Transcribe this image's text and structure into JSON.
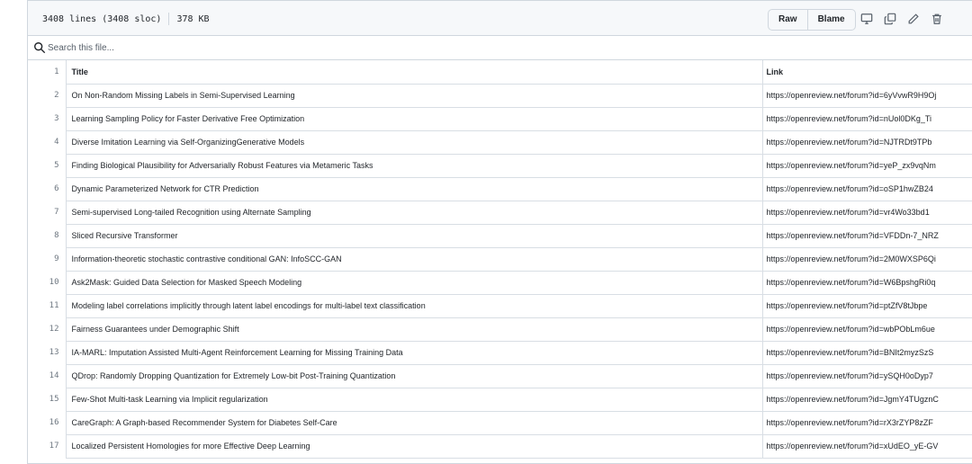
{
  "file_info": {
    "lines": "3408 lines (3408 sloc)",
    "size": "378 KB"
  },
  "toolbar": {
    "raw_label": "Raw",
    "blame_label": "Blame",
    "icons": [
      "display-icon",
      "copy-icon",
      "pencil-icon",
      "trash-icon"
    ]
  },
  "search": {
    "placeholder": "Search this file..."
  },
  "table": {
    "header": {
      "num": "1",
      "title": "Title",
      "link": "Link"
    },
    "rows": [
      {
        "num": "2",
        "title": "On Non-Random Missing Labels in Semi-Supervised Learning",
        "link": "https://openreview.net/forum?id=6yVvwR9H9Oj"
      },
      {
        "num": "3",
        "title": "Learning Sampling Policy for Faster Derivative Free Optimization",
        "link": "https://openreview.net/forum?id=nUol0DKg_Ti"
      },
      {
        "num": "4",
        "title": "Diverse Imitation Learning via Self-OrganizingGenerative Models",
        "link": "https://openreview.net/forum?id=NJTRDt9TPb"
      },
      {
        "num": "5",
        "title": "Finding Biological Plausibility for Adversarially Robust Features via Metameric Tasks",
        "link": "https://openreview.net/forum?id=yeP_zx9vqNm"
      },
      {
        "num": "6",
        "title": "Dynamic Parameterized Network for CTR Prediction",
        "link": "https://openreview.net/forum?id=oSP1hwZB24"
      },
      {
        "num": "7",
        "title": "Semi-supervised Long-tailed Recognition using Alternate Sampling",
        "link": "https://openreview.net/forum?id=vr4Wo33bd1"
      },
      {
        "num": "8",
        "title": "Sliced Recursive Transformer",
        "link": "https://openreview.net/forum?id=VFDDn-7_NRZ"
      },
      {
        "num": "9",
        "title": "Information-theoretic stochastic contrastive conditional GAN: InfoSCC-GAN",
        "link": "https://openreview.net/forum?id=2M0WXSP6Qi"
      },
      {
        "num": "10",
        "title": "Ask2Mask: Guided Data Selection for Masked Speech Modeling",
        "link": "https://openreview.net/forum?id=W6BpshgRi0q"
      },
      {
        "num": "11",
        "title": "Modeling label correlations implicitly through latent label encodings for multi-label text classification",
        "link": "https://openreview.net/forum?id=ptZfV8tJbpe"
      },
      {
        "num": "12",
        "title": "Fairness Guarantees under Demographic Shift",
        "link": "https://openreview.net/forum?id=wbPObLm6ue"
      },
      {
        "num": "13",
        "title": "IA-MARL: Imputation Assisted Multi-Agent Reinforcement Learning for Missing Training Data",
        "link": "https://openreview.net/forum?id=BNIt2myzSzS"
      },
      {
        "num": "14",
        "title": "QDrop: Randomly Dropping Quantization for Extremely Low-bit Post-Training Quantization",
        "link": "https://openreview.net/forum?id=ySQH0oDyp7"
      },
      {
        "num": "15",
        "title": "Few-Shot Multi-task Learning via Implicit regularization",
        "link": "https://openreview.net/forum?id=JgmY4TUgznC"
      },
      {
        "num": "16",
        "title": "CareGraph: A Graph-based Recommender System for Diabetes Self-Care",
        "link": "https://openreview.net/forum?id=rX3rZYP8zZF"
      },
      {
        "num": "17",
        "title": "Localized Persistent Homologies for more Effective Deep Learning",
        "link": "https://openreview.net/forum?id=xUdEO_yE-GV"
      }
    ]
  }
}
